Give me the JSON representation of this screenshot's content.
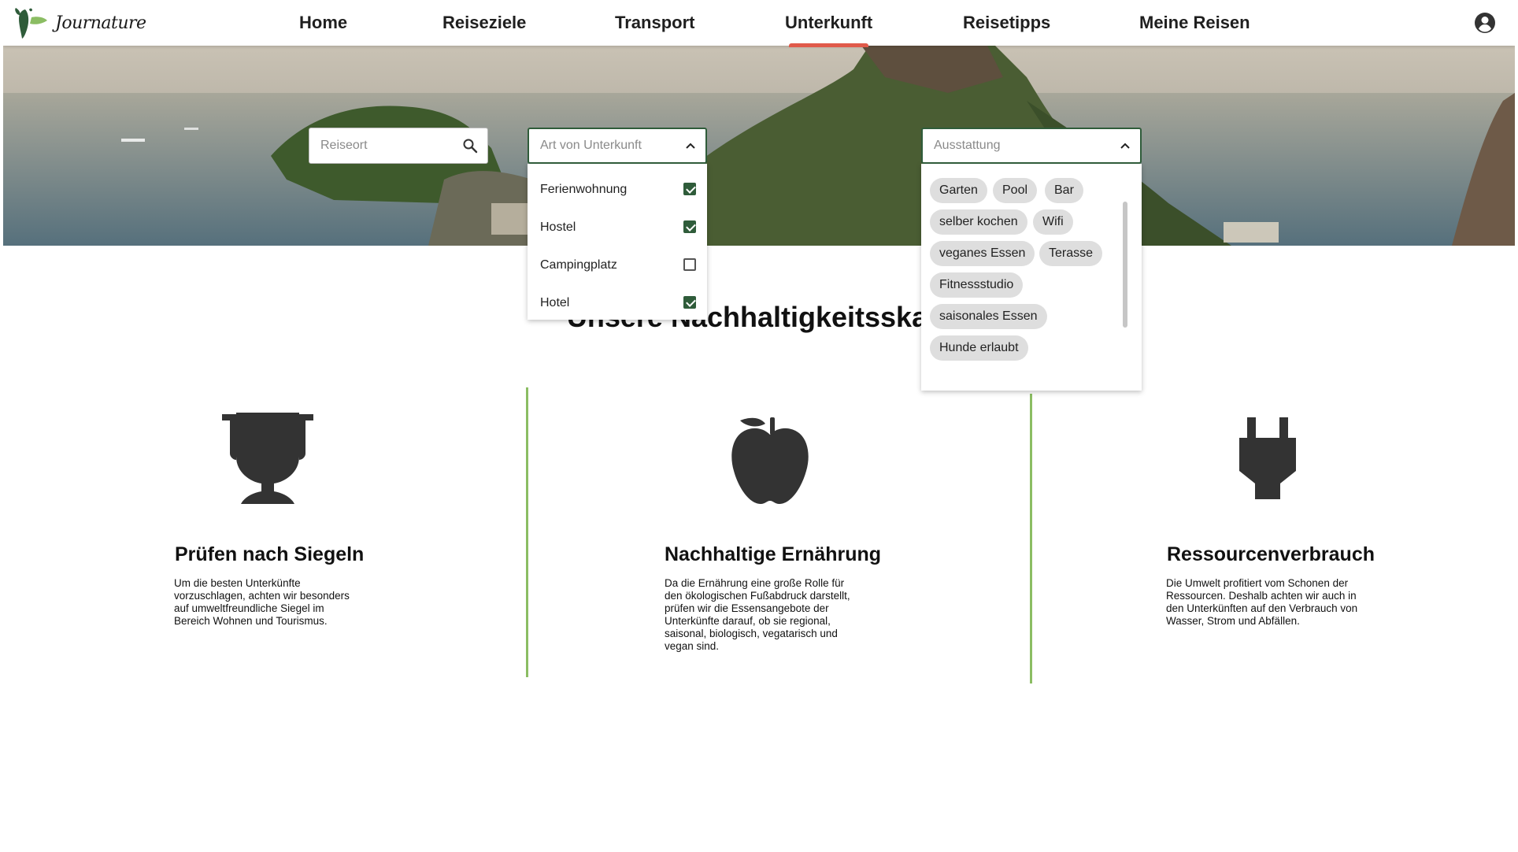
{
  "brand": {
    "name": "Journature"
  },
  "nav": {
    "items": [
      {
        "label": "Home"
      },
      {
        "label": "Reiseziele"
      },
      {
        "label": "Transport"
      },
      {
        "label": "Unterkunft"
      },
      {
        "label": "Reisetipps"
      },
      {
        "label": "Meine Reisen"
      }
    ],
    "active": "Unterkunft"
  },
  "search": {
    "location_placeholder": "Reiseort",
    "accommodation_placeholder": "Art von Unterkunft",
    "amenities_placeholder": "Ausstattung"
  },
  "accommodation_types": [
    {
      "label": "Ferienwohnung",
      "checked": true
    },
    {
      "label": "Hostel",
      "checked": true
    },
    {
      "label": "Campingplatz",
      "checked": false
    },
    {
      "label": "Hotel",
      "checked": true
    }
  ],
  "amenities": [
    "Garten",
    "Pool",
    "Bar",
    "selber kochen",
    "Wifi",
    "veganes Essen",
    "Terasse",
    "Fitnessstudio",
    "saisonales Essen",
    "Hunde erlaubt"
  ],
  "section": {
    "title": "Unsere Nachhaltigkeitsskala"
  },
  "columns": [
    {
      "icon": "trophy-icon",
      "title": "Prüfen nach Siegeln",
      "text": "Um die besten Unterkünfte vorzuschlagen, achten wir besonders auf umweltfreundliche Siegel im Bereich Wohnen und Tourismus."
    },
    {
      "icon": "apple-icon",
      "title": "Nachhaltige Ernährung",
      "text": "Da die Ernährung eine große Rolle für den ökologischen Fußabdruck darstellt, prüfen wir die Essensangebote der Unterkünfte darauf, ob sie regional, saisonal, biologisch, vegatarisch und vegan sind."
    },
    {
      "icon": "plug-icon",
      "title": "Ressourcenverbrauch",
      "text": "Die Umwelt profitiert vom Schonen der Ressourcen. Deshalb achten wir auch in den Unterkünften auf den Verbrauch von Wasser, Strom und Abfällen."
    }
  ],
  "colors": {
    "accent": "#2f5c3a",
    "nav_indicator": "#e05a4a",
    "divider": "#8bbd63",
    "chip": "#dedede"
  }
}
